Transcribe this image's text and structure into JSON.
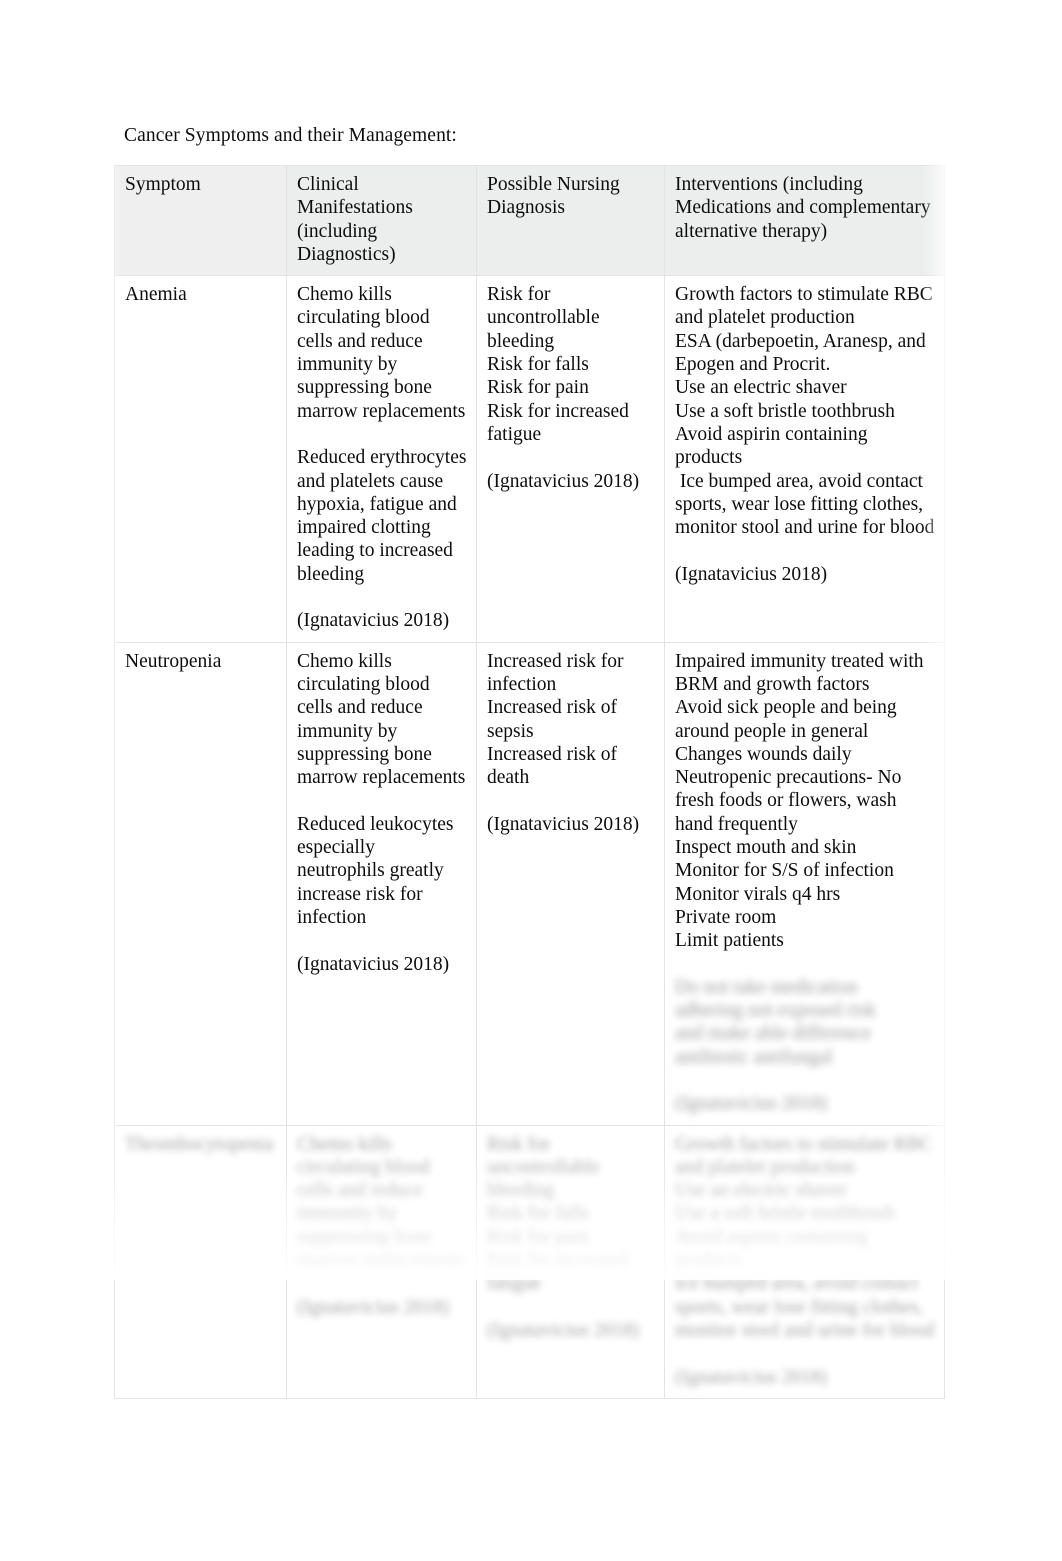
{
  "document": {
    "title": "Cancer Symptoms and their Management:"
  },
  "table": {
    "headers": {
      "symptom": "Symptom",
      "clinical": "Clinical Manifestations (including Diagnostics)",
      "diagnosis": "Possible Nursing Diagnosis",
      "interventions": "Interventions (including Medications and complementary alternative therapy)"
    },
    "rows": [
      {
        "symptom": "Anemia",
        "clinical_1": "Chemo kills circulating blood cells and reduce immunity by suppressing bone marrow replacements",
        "clinical_2": "Reduced erythrocytes and platelets cause hypoxia, fatigue and impaired clotting leading to increased bleeding",
        "clinical_citation": "(Ignatavicius 2018)",
        "diagnosis_1": "Risk for uncontrollable bleeding\nRisk for falls\nRisk for pain\nRisk for increased fatigue",
        "diagnosis_citation": "(Ignatavicius 2018)",
        "interventions_1": "Growth factors to stimulate RBC and platelet production\nESA (darbepoetin, Aranesp, and Epogen and Procrit.\nUse an electric shaver\nUse a soft bristle toothbrush\nAvoid aspirin containing products\n Ice bumped area, avoid contact sports, wear lose fitting clothes, monitor stool and urine for blood",
        "interventions_citation": "(Ignatavicius 2018)"
      },
      {
        "symptom": "Neutropenia",
        "clinical_1": "Chemo kills circulating blood cells and reduce immunity by suppressing bone marrow replacements",
        "clinical_2": "Reduced leukocytes especially neutrophils greatly increase risk for infection",
        "clinical_citation": "(Ignatavicius 2018)",
        "diagnosis_1": "Increased risk for infection\nIncreased risk of sepsis\nIncreased risk of death",
        "diagnosis_citation": "(Ignatavicius 2018)",
        "interventions_1": "Impaired immunity treated with BRM and growth factors\nAvoid sick people and being around people in general\nChanges wounds daily\nNeutropenic precautions- No fresh foods or flowers, wash hand frequently\nInspect mouth and skin\nMonitor for S/S of infection\nMonitor virals q4 hrs\nPrivate room\nLimit patients",
        "interventions_obscured": "Do not take medication\nadhering not exposed risk\nand make able difference\nantibiotic antifungal",
        "interventions_citation": "(Ignatavicius 2018)"
      },
      {
        "symptom": "Thrombocytopenia",
        "clinical_1": "Chemo kills circulating blood cells and reduce immunity by suppressing bone marrow replacements",
        "clinical_2": "",
        "clinical_citation": "(Ignatavicius 2018)",
        "diagnosis_1": "Risk for uncontrollable bleeding\nRisk for falls\nRisk for pain\nRisk for increased fatigue",
        "diagnosis_citation": "(Ignatavicius 2018)",
        "interventions_1": "Growth factors to stimulate RBC and platelet production\nUse an electric shaver\nUse a soft bristle toothbrush\nAvoid aspirin containing products\nIce bumped area, avoid contact sports, wear lose fitting clothes, monitor stool and urine for blood",
        "interventions_citation": "(Ignatavicius 2018)"
      }
    ]
  }
}
